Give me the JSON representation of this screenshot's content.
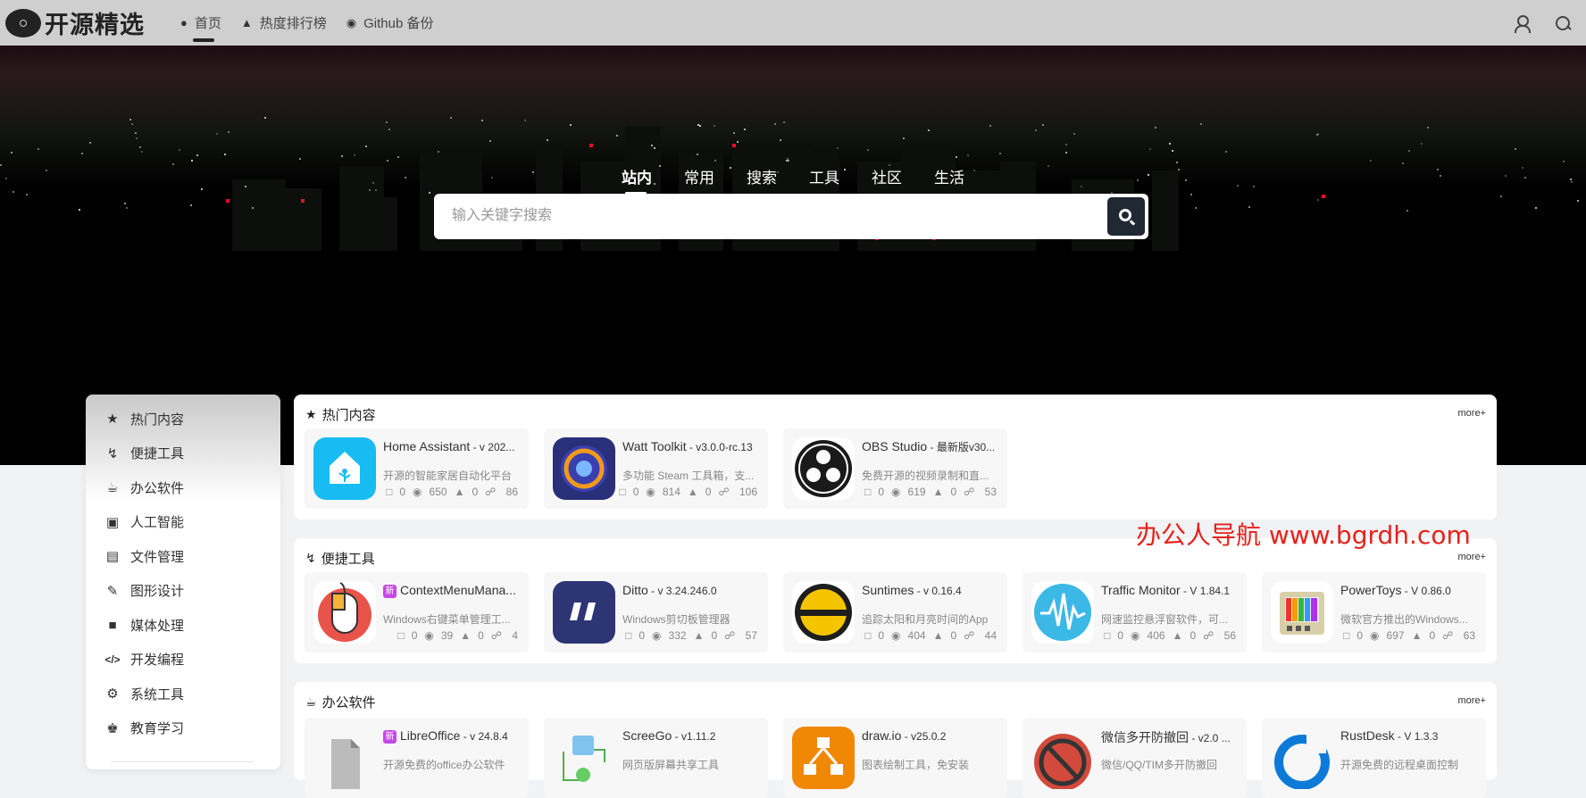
{
  "header": {
    "logo_text": "开源精选",
    "nav": [
      {
        "label": "首页",
        "icon": "user-icon"
      },
      {
        "label": "热度排行榜",
        "icon": "fire-icon"
      },
      {
        "label": "Github 备份",
        "icon": "github-icon"
      }
    ]
  },
  "hero": {
    "tabs": [
      "站内",
      "常用",
      "搜索",
      "工具",
      "社区",
      "生活"
    ],
    "search_placeholder": "输入关键字搜索"
  },
  "sidebar": {
    "items": [
      {
        "label": "热门内容",
        "icon": "star-icon"
      },
      {
        "label": "便捷工具",
        "icon": "lightning-icon"
      },
      {
        "label": "办公软件",
        "icon": "coffee-icon"
      },
      {
        "label": "人工智能",
        "icon": "robot-icon"
      },
      {
        "label": "文件管理",
        "icon": "file-icon"
      },
      {
        "label": "图形设计",
        "icon": "design-icon"
      },
      {
        "label": "媒体处理",
        "icon": "video-icon"
      },
      {
        "label": "开发编程",
        "icon": "code-icon"
      },
      {
        "label": "系统工具",
        "icon": "gear-icon"
      },
      {
        "label": "教育学习",
        "icon": "education-icon"
      }
    ]
  },
  "sections": [
    {
      "title": "热门内容",
      "more": "more+",
      "items": [
        {
          "name": "Home Assistant",
          "version": " - v 202...",
          "desc": "开源的智能家居自动化平台",
          "comments": "0",
          "views": "650",
          "likes": "0",
          "shares": "86"
        },
        {
          "name": "Watt Toolkit",
          "version": " - v3.0.0-rc.13",
          "desc": "多功能 Steam 工具箱，支...",
          "comments": "0",
          "views": "814",
          "likes": "0",
          "shares": "106"
        },
        {
          "name": "OBS Studio",
          "version": " - 最新版v30...",
          "desc": "免费开源的视频录制和直...",
          "comments": "0",
          "views": "619",
          "likes": "0",
          "shares": "53"
        }
      ]
    },
    {
      "title": "便捷工具",
      "more": "more+",
      "items": [
        {
          "name": "ContextMenuMana...",
          "version": "",
          "desc": "Windows右键菜单管理工...",
          "comments": "0",
          "views": "39",
          "likes": "0",
          "shares": "4",
          "new_tag": "新"
        },
        {
          "name": "Ditto",
          "version": " - v 3.24.246.0",
          "desc": "Windows剪切板管理器",
          "comments": "0",
          "views": "332",
          "likes": "0",
          "shares": "57"
        },
        {
          "name": "Suntimes",
          "version": " - v 0.16.4",
          "desc": "追踪太阳和月亮时间的App",
          "comments": "0",
          "views": "404",
          "likes": "0",
          "shares": "44"
        },
        {
          "name": "Traffic Monitor",
          "version": " - V 1.84.1",
          "desc": "网速监控悬浮窗软件，可...",
          "comments": "0",
          "views": "406",
          "likes": "0",
          "shares": "56"
        },
        {
          "name": "PowerToys",
          "version": " - V 0.86.0",
          "desc": "微软官方推出的Windows...",
          "comments": "0",
          "views": "697",
          "likes": "0",
          "shares": "63"
        }
      ]
    },
    {
      "title": "办公软件",
      "more": "more+",
      "items": [
        {
          "name": "LibreOffice",
          "version": " - v 24.8.4",
          "desc": "开源免费的office办公软件",
          "new_tag": "新"
        },
        {
          "name": "ScreeGo",
          "version": " - v1.11.2",
          "desc": "网页版屏幕共享工具"
        },
        {
          "name": "draw.io",
          "version": " - v25.0.2",
          "desc": "图表绘制工具，免安装"
        },
        {
          "name": "微信多开防撤回",
          "version": " - v2.0 ...",
          "desc": "微信/QQ/TIM多开防撤回"
        },
        {
          "name": "RustDesk",
          "version": " - V 1.3.3",
          "desc": "开源免费的远程桌面控制"
        }
      ]
    }
  ],
  "watermark": "办公人导航 www.bgrdh.com"
}
